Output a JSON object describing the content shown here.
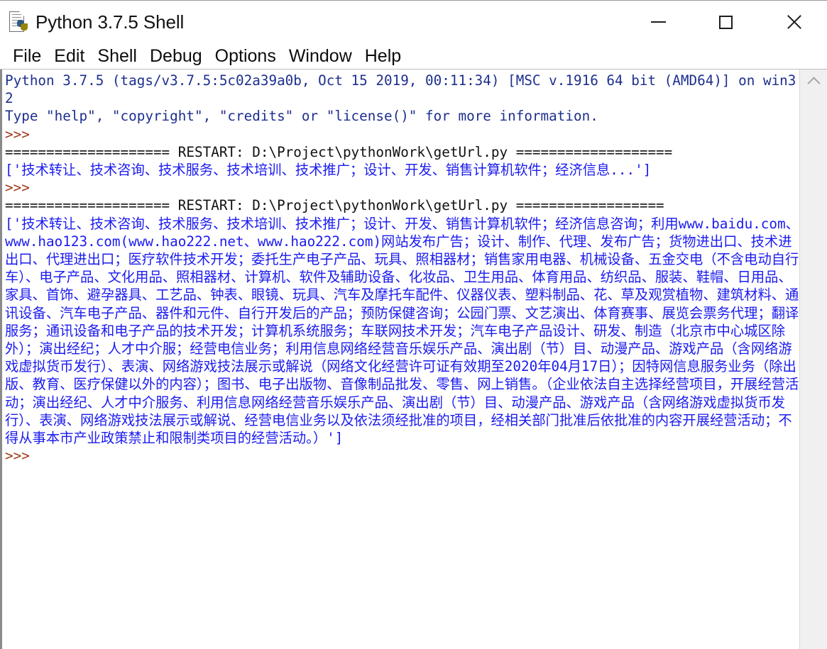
{
  "window": {
    "title": "Python 3.7.5 Shell",
    "app_icon": "python-idle-icon",
    "controls": {
      "minimize": "minimize-icon",
      "maximize": "maximize-icon",
      "close": "close-icon"
    }
  },
  "menubar": {
    "items": [
      {
        "label": "File"
      },
      {
        "label": "Edit"
      },
      {
        "label": "Shell"
      },
      {
        "label": "Debug"
      },
      {
        "label": "Options"
      },
      {
        "label": "Window"
      },
      {
        "label": "Help"
      }
    ]
  },
  "colors": {
    "banner": "#1d2f8e",
    "prompt": "#9c3a18",
    "restart": "#111111",
    "output": "#1b1bf0",
    "background": "#ffffff",
    "scrollbar_track": "#f0f0f0"
  },
  "shell": {
    "lines": [
      {
        "kind": "banner",
        "text": "Python 3.7.5 (tags/v3.7.5:5c02a39a0b, Oct 15 2019, 00:11:34) [MSC v.1916 64 bit (AMD64)] on win32"
      },
      {
        "kind": "banner",
        "text": "Type \"help\", \"copyright\", \"credits\" or \"license()\" for more information."
      },
      {
        "kind": "prompt",
        "text": ">>> "
      },
      {
        "kind": "restart",
        "text": "==================== RESTART: D:\\Project\\pythonWork\\getUrl.py ==================="
      },
      {
        "kind": "output",
        "text": "['技术转让、技术咨询、技术服务、技术培训、技术推广；设计、开发、销售计算机软件；经济信息...']"
      },
      {
        "kind": "prompt",
        "text": ">>> "
      },
      {
        "kind": "restart",
        "text": "==================== RESTART: D:\\Project\\pythonWork\\getUrl.py =================="
      },
      {
        "kind": "output",
        "text": "['技术转让、技术咨询、技术服务、技术培训、技术推广；设计、开发、销售计算机软件；经济信息咨询；利用www.baidu.com、www.hao123.com(www.hao222.net、www.hao222.com)网站发布广告；设计、制作、代理、发布广告；货物进出口、技术进出口、代理进出口；医疗软件技术开发；委托生产电子产品、玩具、照相器材；销售家用电器、机械设备、五金交电（不含电动自行车）、电子产品、文化用品、照相器材、计算机、软件及辅助设备、化妆品、卫生用品、体育用品、纺织品、服装、鞋帽、日用品、家具、首饰、避孕器具、工艺品、钟表、眼镜、玩具、汽车及摩托车配件、仪器仪表、塑料制品、花、草及观赏植物、建筑材料、通讯设备、汽车电子产品、器件和元件、自行开发后的产品；预防保健咨询；公园门票、文艺演出、体育赛事、展览会票务代理；翻译服务；通讯设备和电子产品的技术开发；计算机系统服务；车联网技术开发；汽车电子产品设计、研发、制造（北京市中心城区除外）；演出经纪；人才中介服；经营电信业务；利用信息网络经营音乐娱乐产品、演出剧（节）目、动漫产品、游戏产品（含网络游戏虚拟货币发行）、表演、网络游戏技法展示或解说（网络文化经营许可证有效期至2020年04月17日）；因特网信息服务业务（除出版、教育、医疗保健以外的内容）；图书、电子出版物、音像制品批发、零售、网上销售。（企业依法自主选择经营项目，开展经营活动；演出经纪、人才中介服务、利用信息网络经营音乐娱乐产品、演出剧（节）目、动漫产品、游戏产品（含网络游戏虚拟货币发行）、表演、网络游戏技法展示或解说、经营电信业务以及依法须经批准的项目，经相关部门批准后依批准的内容开展经营活动；不得从事本市产业政策禁止和限制类项目的经营活动。）']"
      },
      {
        "kind": "prompt",
        "text": ">>> "
      }
    ]
  },
  "scrollbar": {
    "up_arrow": "chevron-up-icon"
  }
}
